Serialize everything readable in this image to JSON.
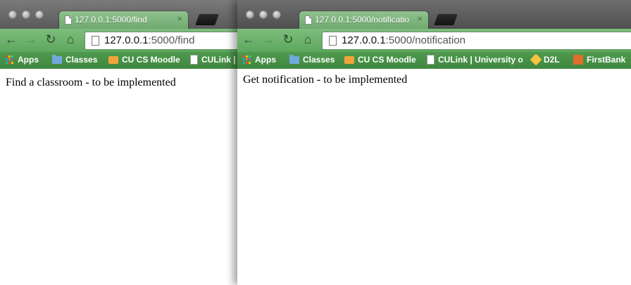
{
  "left_window": {
    "tab_title": "127.0.0.1:5000/find",
    "url_host": "127.0.0.1",
    "url_path": ":5000/find",
    "page_text": "Find a classroom - to be implemented",
    "bookmarks": {
      "apps": "Apps",
      "classes": "Classes",
      "moodle": "CU CS Moodle",
      "culink": "CULink |"
    }
  },
  "right_window": {
    "tab_title": "127.0.0.1:5000/notificatio",
    "url_host": "127.0.0.1",
    "url_path": ":5000/notification",
    "page_text": "Get notification - to be implemented",
    "bookmarks": {
      "apps": "Apps",
      "classes": "Classes",
      "moodle": "CU CS Moodle",
      "culink": "CULink | University o",
      "d2l": "D2L",
      "firstbank": "FirstBank"
    }
  },
  "icons": {
    "back": "back-arrow-icon",
    "forward": "forward-arrow-icon",
    "reload": "reload-icon",
    "home": "home-icon",
    "close_tab": "close-icon"
  },
  "colors": {
    "theme_green": "#6faa6f",
    "bookmark_bar": "#4f9a4f",
    "titlebar": "#5a5a5a"
  }
}
